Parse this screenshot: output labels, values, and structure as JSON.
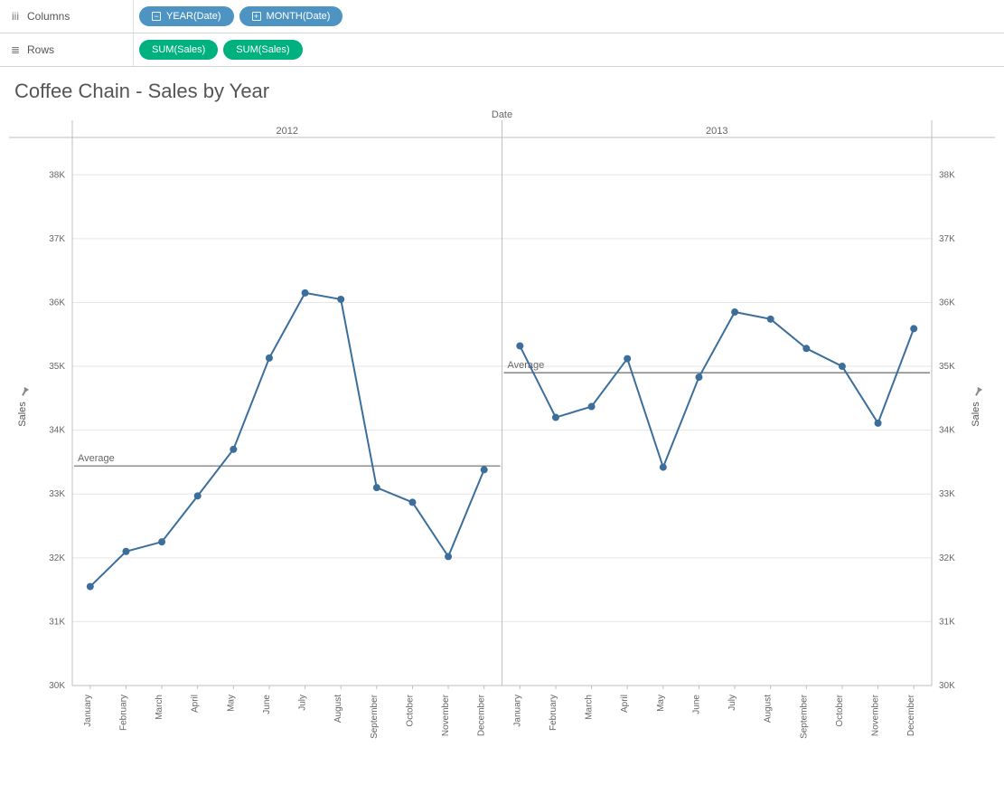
{
  "shelves": {
    "columns_label": "Columns",
    "rows_label": "Rows",
    "columns_pills": [
      {
        "label": "YEAR(Date)",
        "expand": "minus"
      },
      {
        "label": "MONTH(Date)",
        "expand": "plus"
      }
    ],
    "rows_pills": [
      {
        "label": "SUM(Sales)"
      },
      {
        "label": "SUM(Sales)"
      }
    ]
  },
  "title": "Coffee Chain - Sales by Year",
  "chart_data": {
    "type": "line",
    "title": "Coffee Chain - Sales by Year",
    "column_header_title": "Date",
    "panels": [
      "2012",
      "2013"
    ],
    "categories": [
      "January",
      "February",
      "March",
      "April",
      "May",
      "June",
      "July",
      "August",
      "September",
      "October",
      "November",
      "December"
    ],
    "series": [
      {
        "name": "2012",
        "values": [
          31550,
          32100,
          32250,
          32970,
          33700,
          35130,
          36150,
          36050,
          33100,
          32870,
          32020,
          33380
        ]
      },
      {
        "name": "2013",
        "values": [
          35320,
          34200,
          34370,
          35120,
          33420,
          34830,
          35850,
          35740,
          35280,
          35000,
          34110,
          35590
        ]
      }
    ],
    "reference_lines": [
      {
        "panel": "2012",
        "label": "Average",
        "value": 33440
      },
      {
        "panel": "2013",
        "label": "Average",
        "value": 34900
      }
    ],
    "ylabel": "Sales",
    "ylim": [
      30000,
      38500
    ],
    "yticks": [
      30000,
      31000,
      32000,
      33000,
      34000,
      35000,
      36000,
      37000,
      38000
    ],
    "ytick_labels": [
      "30K",
      "31K",
      "32K",
      "33K",
      "34K",
      "35K",
      "36K",
      "37K",
      "38K"
    ],
    "grid": true
  }
}
